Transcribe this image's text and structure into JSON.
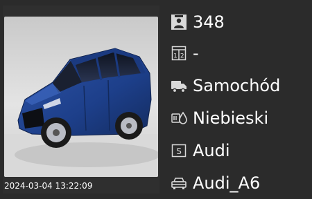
{
  "camera": {
    "timestamp": "2024-03-04 13:22:09"
  },
  "info": {
    "id": {
      "icon": "person-badge-icon",
      "value": "348"
    },
    "lane": {
      "icon": "grid-12-icon",
      "value": "-"
    },
    "type": {
      "icon": "truck-icon",
      "value": "Samochód"
    },
    "color": {
      "icon": "color-drop-icon",
      "value": "Niebieski"
    },
    "brand": {
      "icon": "s-box-icon",
      "value": "Audi"
    },
    "model": {
      "icon": "car-icon",
      "value": "Audi_A6"
    }
  },
  "colors": {
    "background": "#2b2b2b",
    "icon_fill": "#d9d9d9",
    "text": "#ffffff"
  }
}
